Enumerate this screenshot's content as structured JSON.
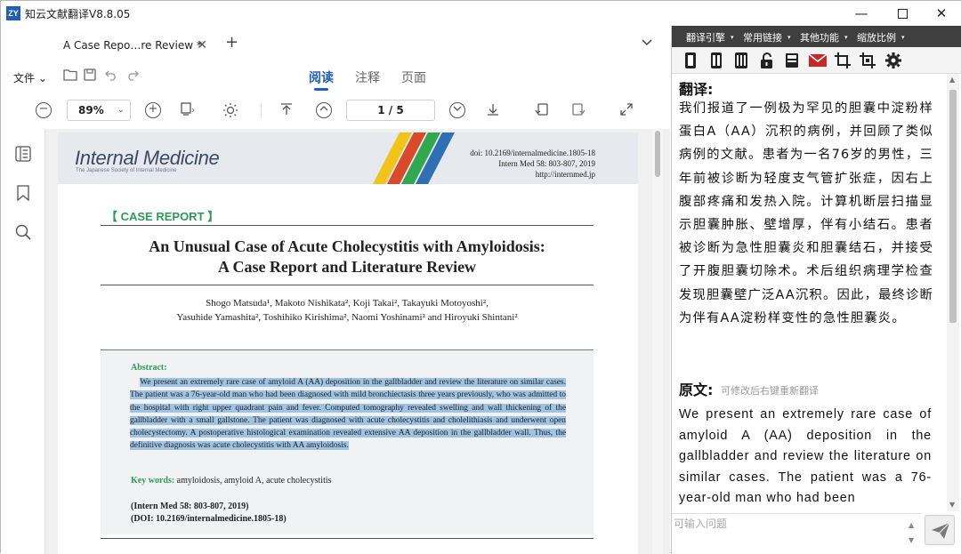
{
  "window": {
    "title": "知云文献翻译V8.8.05",
    "logo_text": "ZY",
    "minimize": "—",
    "maximize": "☐",
    "close": "✕"
  },
  "tabs": {
    "active_label": "A Case Repo…re Review *",
    "close": "✕",
    "new": "+",
    "menu": "⌄"
  },
  "toolbar": {
    "file_menu": "文件 ⌄",
    "modes": [
      "阅读",
      "注释",
      "页面"
    ],
    "zoom_value": "89%",
    "zoom_arrow": "⌄",
    "page_indicator": "1 / 5"
  },
  "pdf": {
    "journal_name": "Internal Medicine",
    "journal_subtitle": "The Japanese Society of Internal Medicine",
    "doi_lines": [
      "doi: 10.2169/internalmedicine.1805-18",
      "Intern Med 58: 803-807, 2019",
      "http://internmed.jp"
    ],
    "category": "【 CASE REPORT 】",
    "title_line1": "An Unusual Case of Acute Cholecystitis with Amyloidosis:",
    "title_line2": "A Case Report and Literature Review",
    "authors_line1": "Shogo Matsuda¹, Makoto Nishikata², Koji Takai², Takayuki Motoyoshi²,",
    "authors_line2": "Yasuhide Yamashita², Toshihiko Kirishima², Naomi Yoshinami² and Hiroyuki Shintani²",
    "abstract_heading": "Abstract:",
    "abstract_text": "We present an extremely rare case of amyloid A (AA) deposition in the gallbladder and review the literature on similar cases. The patient was a 76-year-old man who had been diagnosed with mild bronchiectasis three years previously, who was admitted to the hospital with right upper quadrant pain and fever. Computed tomography revealed swelling and wall thickening of the gallbladder with a small gallstone. The patient was diagnosed with acute cholecystitis and cholelithiasis and underwent open cholecystectomy. A postoperative histological examination revealed extensive AA deposition in the gallbladder wall. Thus, the definitive diagnosis was acute cholecystitis with AA amyloidosis.",
    "keywords_label": "Key words:",
    "keywords": "amyloidosis, amyloid A, acute cholecystitis",
    "citation1": "(Intern Med 58: 803-807, 2019)",
    "citation2": "(DOI: 10.2169/internalmedicine.1805-18)"
  },
  "panel": {
    "menu": [
      "翻译引擎",
      "常用链接",
      "其他功能",
      "缩放比例"
    ],
    "translation_heading": "翻译:",
    "translation_text": "我们报道了一例极为罕见的胆囊中淀粉样蛋白A（AA）沉积的病例，并回顾了类似病例的文献。患者为一名76岁的男性，三年前被诊断为轻度支气管扩张症，因右上腹部疼痛和发热入院。计算机断层扫描显示胆囊肿胀、壁增厚，伴有小结石。患者被诊断为急性胆囊炎和胆囊结石，并接受了开腹胆囊切除术。术后组织病理学检查发现胆囊壁广泛AA沉积。因此，最终诊断为伴有AA淀粉样变性的急性胆囊炎。",
    "original_heading": "原文:",
    "original_hint": "可修改后右键重新翻译",
    "original_text": "We present an extremely rare case of amyloid A (AA) deposition in the gallbladder and review the literature on similar cases. The patient was a 76-year-old man who had been",
    "ask_placeholder": "可输入问题"
  },
  "colors": {
    "accent": "#1f5fb5",
    "panel_menu_bg": "#3f3f3f",
    "highlight": "#9fc3e2",
    "green": "#2f9a52"
  }
}
